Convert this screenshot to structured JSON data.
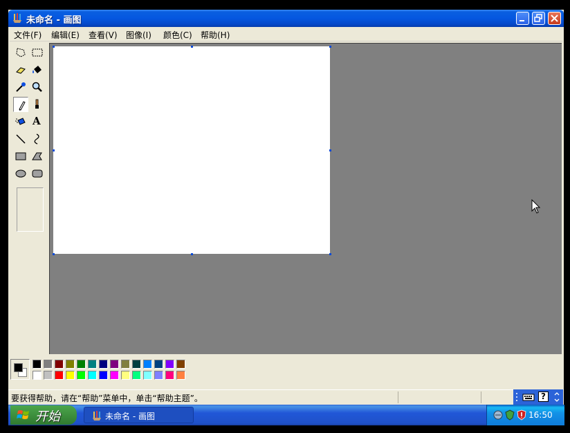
{
  "window": {
    "title": "未命名 - 画图",
    "controls": [
      "minimize",
      "restore",
      "close"
    ]
  },
  "menu": {
    "items": [
      "文件(F)",
      "编辑(E)",
      "查看(V)",
      "图像(I)",
      "颜色(C)",
      "帮助(H)"
    ]
  },
  "toolbox": {
    "tools": [
      "free-form-select-icon",
      "select-icon",
      "eraser-icon",
      "fill-icon",
      "pick-color-icon",
      "magnifier-icon",
      "pencil-icon",
      "brush-icon",
      "airbrush-icon",
      "text-icon",
      "line-icon",
      "curve-icon",
      "rectangle-icon",
      "polygon-icon",
      "ellipse-icon",
      "rounded-rectangle-icon"
    ],
    "active_tool": "pencil-icon",
    "text_tool_glyph": "A"
  },
  "palette": {
    "foreground": "#000000",
    "background": "#ffffff",
    "row1": [
      "#000000",
      "#808080",
      "#800000",
      "#808000",
      "#008000",
      "#008080",
      "#000080",
      "#800080",
      "#808040",
      "#004040",
      "#0080ff",
      "#004080",
      "#8000ff",
      "#804000"
    ],
    "row2": [
      "#ffffff",
      "#c0c0c0",
      "#ff0000",
      "#ffff00",
      "#00ff00",
      "#00ffff",
      "#0000ff",
      "#ff00ff",
      "#ffff80",
      "#00ff80",
      "#80ffff",
      "#8080ff",
      "#ff0080",
      "#ff8040"
    ]
  },
  "status": {
    "text": "要获得帮助，请在“帮助”菜单中，单击“帮助主题”。"
  },
  "taskbar": {
    "start_label": "开始",
    "task_label": "未命名 - 画图",
    "clock": "16:50",
    "language_bar_help": "?"
  }
}
